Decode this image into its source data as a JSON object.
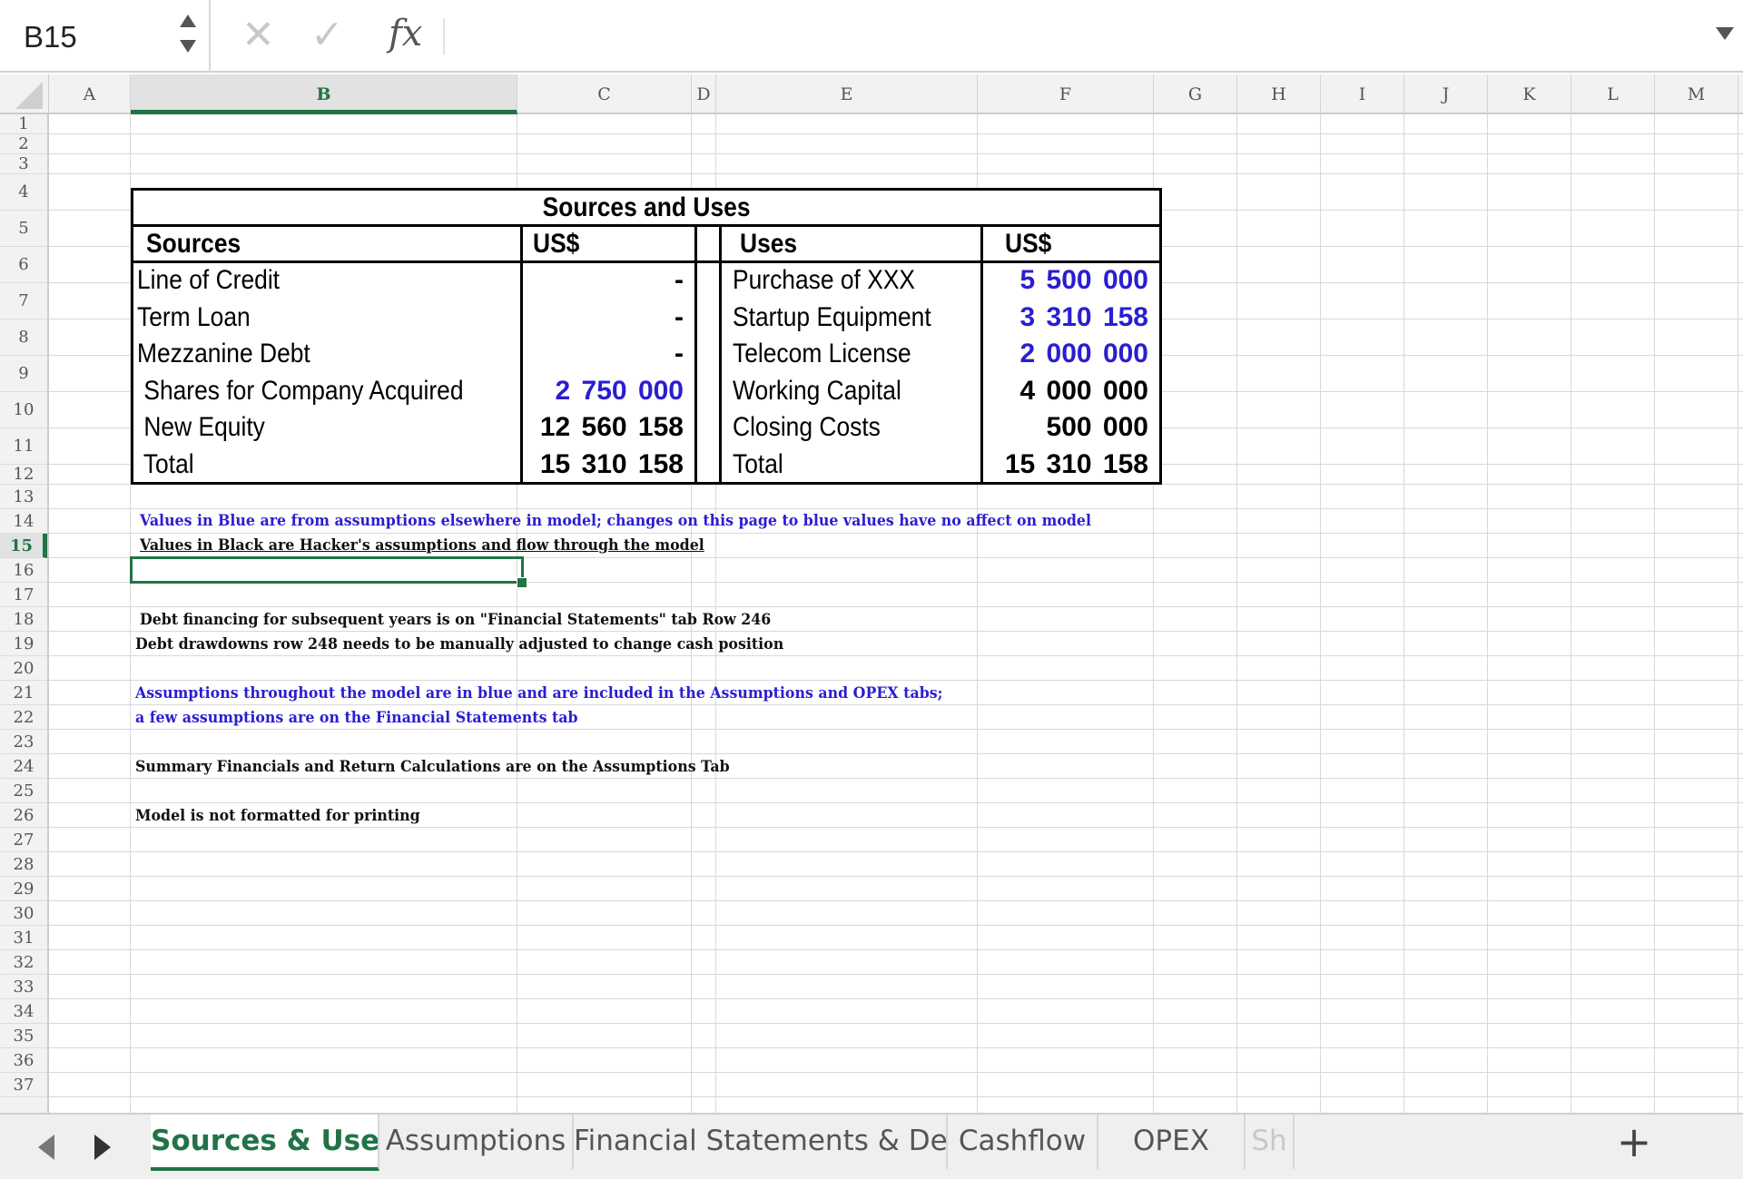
{
  "formula_bar": {
    "name_box": "B15",
    "fx_label": "fx",
    "cancel_glyph": "✕",
    "confirm_glyph": "✓",
    "formula_value": ""
  },
  "columns": [
    "A",
    "B",
    "C",
    "D",
    "E",
    "F",
    "G",
    "H",
    "I",
    "J",
    "K",
    "L",
    "M"
  ],
  "active_column": "B",
  "rows": [
    "1",
    "2",
    "3",
    "4",
    "5",
    "6",
    "7",
    "8",
    "9",
    "10",
    "11",
    "12",
    "13",
    "14",
    "15",
    "16",
    "17",
    "18",
    "19",
    "20",
    "21",
    "22",
    "23",
    "24",
    "25",
    "26",
    "27",
    "28",
    "29",
    "30",
    "31",
    "32",
    "33",
    "34",
    "35",
    "36",
    "37"
  ],
  "active_row": "15",
  "sources_uses": {
    "title": "Sources and Uses",
    "sources_header": "Sources",
    "sources_currency": "US$",
    "uses_header": "Uses",
    "uses_currency": "US$",
    "rows": [
      {
        "source": "Line of Credit",
        "source_value": "-",
        "source_blue": false,
        "use": "Purchase of XXX",
        "use_value": "5 500 000",
        "use_blue": true
      },
      {
        "source": "Term Loan",
        "source_value": "-",
        "source_blue": false,
        "use": "Startup Equipment",
        "use_value": "3 310 158",
        "use_blue": true
      },
      {
        "source": "Mezzanine Debt",
        "source_value": "-",
        "source_blue": false,
        "use": "Telecom License",
        "use_value": "2 000 000",
        "use_blue": true
      },
      {
        "source": " Shares for Company Acquired",
        "source_value": "2 750 000",
        "source_blue": true,
        "use": "Working Capital",
        "use_value": "4 000 000",
        "use_blue": false
      },
      {
        "source": " New Equity",
        "source_value": "12 560 158",
        "source_blue": false,
        "use": "Closing Costs",
        "use_value": "500 000",
        "use_blue": false
      },
      {
        "source": " Total",
        "source_value": "15 310 158",
        "source_blue": false,
        "use": "Total",
        "use_value": "15 310 158",
        "use_blue": false
      }
    ]
  },
  "notes": {
    "r13": "Values in Blue are from assumptions elsewhere in model; changes on this page to blue values have no affect on model",
    "r14": "Values in Black are Hacker's assumptions and flow through the model",
    "r17": "Debt financing for subsequent years is on \"Financial Statements\" tab Row 246",
    "r18": "Debt drawdowns row 248 needs to be manually adjusted to change cash position",
    "r20": "Assumptions throughout the model are in blue and are included in the Assumptions and OPEX tabs;",
    "r21": "a few assumptions are on the Financial Statements tab",
    "r23": "Summary Financials and Return Calculations are on the Assumptions Tab",
    "r25": "Model is not formatted for printing"
  },
  "sheet_tabs": [
    "Sources & Uses",
    "Assumptions",
    "Financial Statements & Detail",
    "Cashflow",
    "OPEX",
    "Sh"
  ],
  "active_tab": "Sources & Uses",
  "add_sheet_glyph": "+",
  "colors": {
    "excel_green": "#217346",
    "value_blue": "#2a1ed0"
  }
}
